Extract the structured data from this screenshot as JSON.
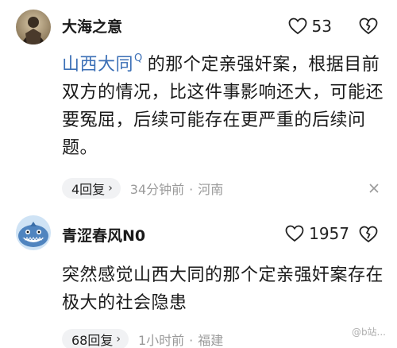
{
  "comments": [
    {
      "username": "大海之意",
      "likes": "53",
      "mention": "山西大同",
      "search_hint": "Q",
      "text_after_mention": "的那个定亲强奸案，根据目前双方的情况，比这件事影响还大，可能还要冤屈，后续可能存在更严重的后续问题。",
      "replies": "4回复",
      "time": "34分钟前",
      "location": "河南"
    },
    {
      "username": "青涩春风N0",
      "likes": "1957",
      "text": "突然感觉山西大同的那个定亲强奸案存在极大的社会隐患",
      "replies": "68回复",
      "time": "1小时前",
      "location": "福建"
    }
  ],
  "watermark": "@b站...",
  "colors": {
    "mention": "#3b6fb6",
    "meta": "#9a9a9a",
    "pill": "#f1f2f4"
  },
  "icons": {
    "like": "heart-outline-icon",
    "dislike": "broken-heart-icon",
    "search": "search-hint-icon",
    "reply_chevron": "chevron-right-icon",
    "collapse": "close-icon"
  }
}
